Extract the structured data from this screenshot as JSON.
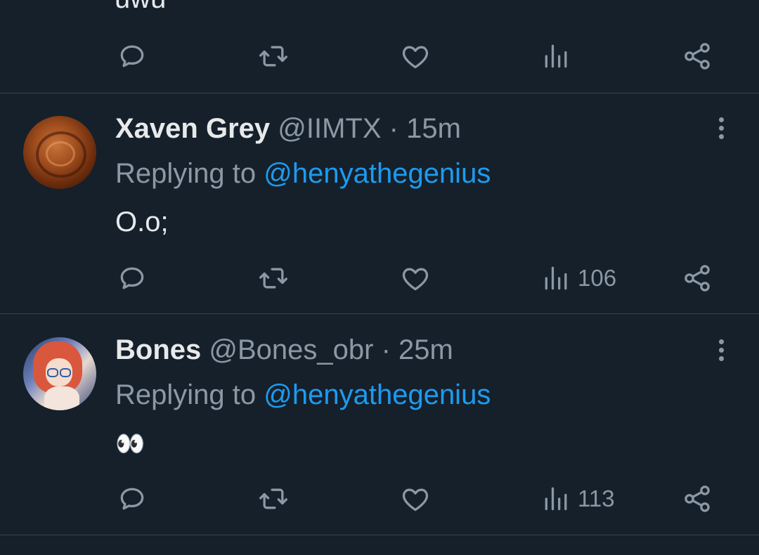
{
  "top_partial_text": "uwu",
  "action_icons": [
    "reply-icon",
    "repost-icon",
    "like-icon",
    "views-icon",
    "share-icon"
  ],
  "colors": {
    "background": "#15202b",
    "text": "#e7e9ea",
    "muted": "#8b98a5",
    "link": "#1d9bf0",
    "divider": "#38444d"
  },
  "tweets": [
    {
      "display_name": "Xaven Grey",
      "handle": "@IIMTX",
      "separator": "·",
      "time": "15m",
      "replying_prefix": "Replying to",
      "replying_to": "@henyathegenius",
      "text": "O.o;",
      "views": "106"
    },
    {
      "display_name": "Bones",
      "handle": "@Bones_obr",
      "separator": "·",
      "time": "25m",
      "replying_prefix": "Replying to",
      "replying_to": "@henyathegenius",
      "text": "👀",
      "views": "113"
    }
  ]
}
